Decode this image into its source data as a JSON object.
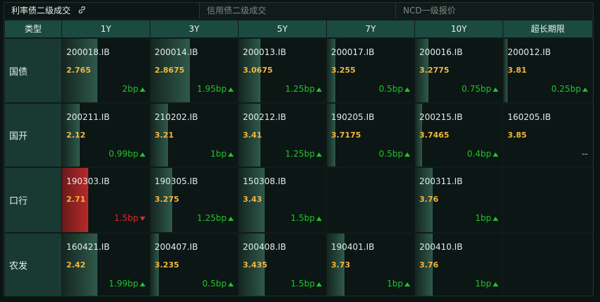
{
  "tabs": [
    {
      "label": "利率债二级成交",
      "active": true,
      "icon": "link-icon"
    },
    {
      "label": "信用债二级成交",
      "active": false
    },
    {
      "label": "NCD一级报价",
      "active": false
    }
  ],
  "header": {
    "type_label": "类型",
    "columns": [
      "1Y",
      "3Y",
      "5Y",
      "7Y",
      "10Y",
      "超长期限"
    ]
  },
  "colors": {
    "up": "#21c22d",
    "down": "#e2262c",
    "price": "#f2b640",
    "header_bg": "#1b4a40",
    "row_label_bg": "#183a33"
  },
  "rows": [
    {
      "label": "国债",
      "cells": [
        {
          "code": "200018.IB",
          "price": "2.765",
          "change": "2bp",
          "dir": "up",
          "level": 0.4
        },
        {
          "code": "200014.IB",
          "price": "2.8675",
          "change": "1.95bp",
          "dir": "up",
          "level": 0.45
        },
        {
          "code": "200013.IB",
          "price": "3.0675",
          "change": "1.25bp",
          "dir": "up",
          "level": 0.25
        },
        {
          "code": "200017.IB",
          "price": "3.255",
          "change": "0.5bp",
          "dir": "up",
          "level": 0.1
        },
        {
          "code": "200016.IB",
          "price": "3.2775",
          "change": "0.75bp",
          "dir": "up",
          "level": 0.15
        },
        {
          "code": "200012.IB",
          "price": "3.81",
          "change": "0.25bp",
          "dir": "up",
          "level": 0.05
        }
      ]
    },
    {
      "label": "国开",
      "cells": [
        {
          "code": "200211.IB",
          "price": "2.12",
          "change": "0.99bp",
          "dir": "up",
          "level": 0.2
        },
        {
          "code": "210202.IB",
          "price": "3.21",
          "change": "1bp",
          "dir": "up",
          "level": 0.2
        },
        {
          "code": "200212.IB",
          "price": "3.41",
          "change": "1.25bp",
          "dir": "up",
          "level": 0.25
        },
        {
          "code": "190205.IB",
          "price": "3.7175",
          "change": "0.5bp",
          "dir": "up",
          "level": 0.1
        },
        {
          "code": "200215.IB",
          "price": "3.7465",
          "change": "0.4bp",
          "dir": "up",
          "level": 0.08
        },
        {
          "code": "160205.IB",
          "price": "3.85",
          "change": "--",
          "dir": "none",
          "level": 0
        }
      ]
    },
    {
      "label": "口行",
      "cells": [
        {
          "code": "190303.IB",
          "price": "2.71",
          "change": "1.5bp",
          "dir": "down",
          "level": 0.3
        },
        {
          "code": "190305.IB",
          "price": "3.275",
          "change": "1.25bp",
          "dir": "up",
          "level": 0.25
        },
        {
          "code": "150308.IB",
          "price": "3.43",
          "change": "1.5bp",
          "dir": "up",
          "level": 0.3
        },
        null,
        {
          "code": "200311.IB",
          "price": "3.76",
          "change": "1bp",
          "dir": "up",
          "level": 0.2
        },
        null
      ]
    },
    {
      "label": "农发",
      "cells": [
        {
          "code": "160421.IB",
          "price": "2.42",
          "change": "1.99bp",
          "dir": "up",
          "level": 0.4
        },
        {
          "code": "200407.IB",
          "price": "3.235",
          "change": "0.5bp",
          "dir": "up",
          "level": 0.1
        },
        {
          "code": "200408.IB",
          "price": "3.435",
          "change": "1.5bp",
          "dir": "up",
          "level": 0.3
        },
        {
          "code": "190401.IB",
          "price": "3.73",
          "change": "1bp",
          "dir": "up",
          "level": 0.2
        },
        {
          "code": "200410.IB",
          "price": "3.76",
          "change": "1bp",
          "dir": "up",
          "level": 0.2
        },
        null
      ]
    }
  ]
}
